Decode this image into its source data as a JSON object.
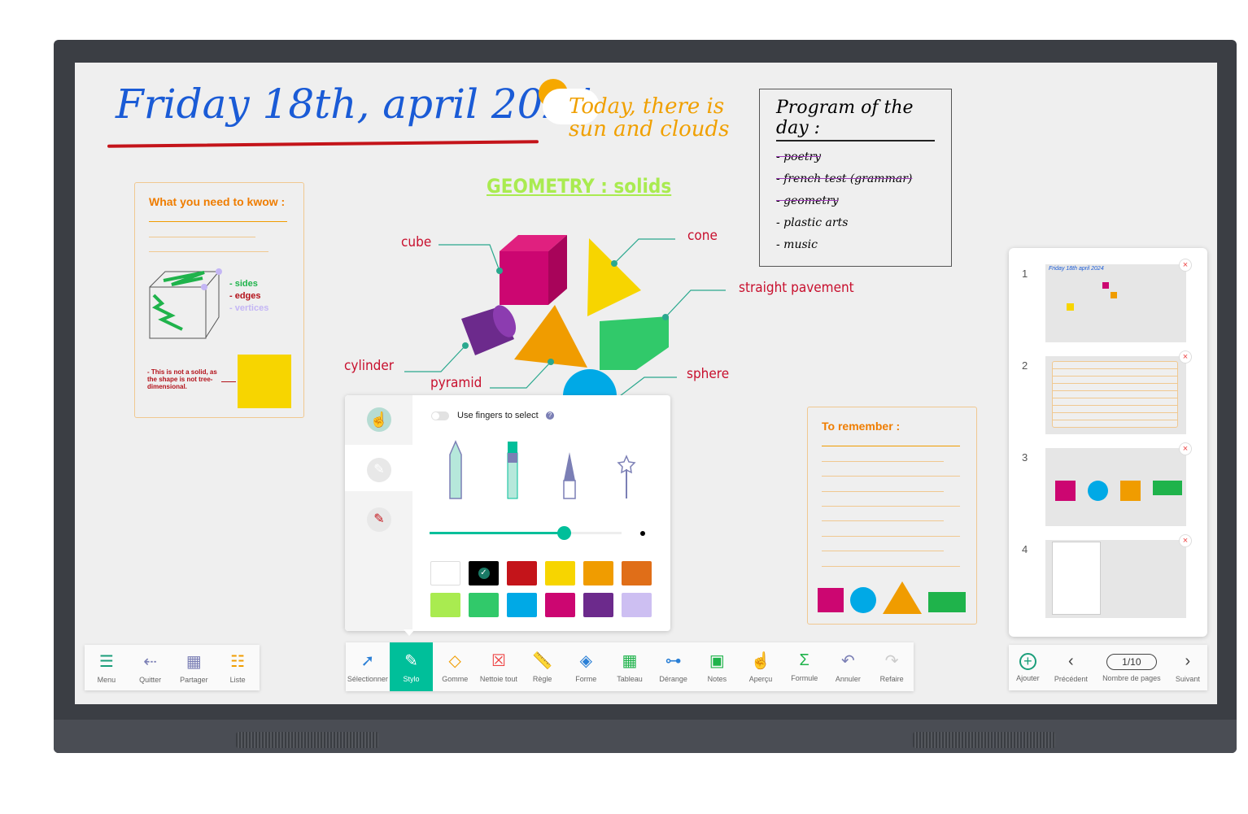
{
  "board": {
    "date_title": "Friday 18th, april 2024",
    "weather": "Today, there is sun and clouds",
    "program": {
      "title": "Program of the day :",
      "items": [
        {
          "text": "- poetry",
          "done": true
        },
        {
          "text": "- french test (grammar)",
          "done": true
        },
        {
          "text": "- geometry",
          "done": true
        },
        {
          "text": "- plastic arts",
          "done": false
        },
        {
          "text": "- music",
          "done": false
        }
      ]
    },
    "geometry_title": "GEOMETRY : solids",
    "shape_labels": {
      "cube": "cube",
      "cone": "cone",
      "straight": "straight pavement",
      "cylinder": "cylinder",
      "pyramid": "pyramid",
      "sphere": "sphere"
    },
    "know_card": {
      "title": "What you need to kwow :",
      "sides": "- sides",
      "edges": "- edges",
      "vertices": "- vertices",
      "note": "- This is not a solid, as the shape is not tree-dimensional."
    },
    "remember_card": {
      "title": "To remember :"
    }
  },
  "pen_panel": {
    "toggle_label": "Use fingers to select",
    "toggle_on": false,
    "size_percent": 70,
    "colors": [
      "#ffffff",
      "#000000",
      "#c4141a",
      "#f7d500",
      "#f09c00",
      "#e06e18",
      "#a9eb50",
      "#31c96a",
      "#00a9e6",
      "#cc0671",
      "#6c2a8c",
      "#cdbff2"
    ],
    "selected_color": "#000000"
  },
  "toolbar_left": [
    {
      "label": "Menu",
      "icon": "menu-icon"
    },
    {
      "label": "Quitter",
      "icon": "exit-icon"
    },
    {
      "label": "Partager",
      "icon": "share-qr-icon"
    },
    {
      "label": "Liste",
      "icon": "list-icon"
    }
  ],
  "toolbar_main": [
    {
      "label": "Sélectionner",
      "icon": "cursor-icon"
    },
    {
      "label": "Stylo",
      "icon": "pen-icon",
      "active": true
    },
    {
      "label": "Gomme",
      "icon": "eraser-icon"
    },
    {
      "label": "Nettoie tout",
      "icon": "clear-icon"
    },
    {
      "label": "Règle",
      "icon": "ruler-icon"
    },
    {
      "label": "Forme",
      "icon": "shapes-icon"
    },
    {
      "label": "Tableau",
      "icon": "table-icon"
    },
    {
      "label": "Dérange",
      "icon": "mindmap-icon"
    },
    {
      "label": "Notes",
      "icon": "notes-icon"
    },
    {
      "label": "Aperçu",
      "icon": "touch-icon"
    },
    {
      "label": "Formule",
      "icon": "formula-icon"
    },
    {
      "label": "Annuler",
      "icon": "undo-icon"
    },
    {
      "label": "Refaire",
      "icon": "redo-icon"
    }
  ],
  "pages": {
    "thumbs": [
      "1",
      "2",
      "3",
      "4"
    ],
    "add": "Ajouter",
    "prev": "Précédent",
    "counter": "1/10",
    "counter_label": "Nombre de pages",
    "next": "Suivant"
  },
  "accent": "#00bf9a"
}
